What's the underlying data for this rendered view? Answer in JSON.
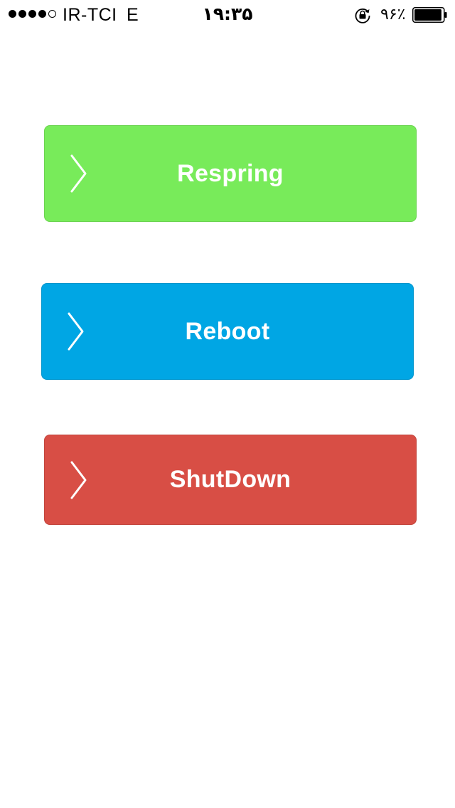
{
  "status_bar": {
    "signal_bars_filled": 4,
    "signal_bars_total": 5,
    "carrier": "IR-TCI",
    "network": "E",
    "time": "۱۹:۳۵",
    "rotation_lock_icon": "rotation-lock-icon",
    "battery_percent": "۹۶٪",
    "battery_level": 0.96
  },
  "buttons": {
    "respring": {
      "label": "Respring",
      "color": "#78eb5a",
      "icon": "chevron-right-icon"
    },
    "reboot": {
      "label": "Reboot",
      "color": "#00a6e4",
      "icon": "chevron-right-icon"
    },
    "shutdown": {
      "label": "ShutDown",
      "color": "#d84e45",
      "icon": "chevron-right-icon"
    }
  }
}
